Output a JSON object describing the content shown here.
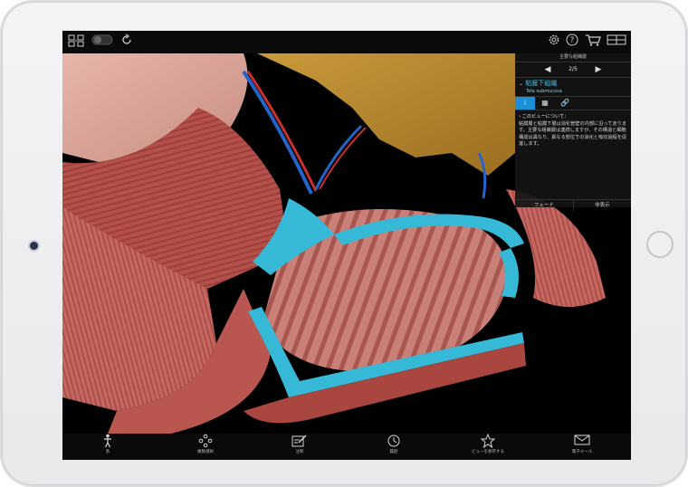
{
  "topbar": {
    "icons": [
      "layers-icon",
      "toggle-icon",
      "reset-icon",
      "settings-icon",
      "help-icon",
      "cart-icon",
      "views-icon"
    ],
    "help_glyph": "?"
  },
  "panel": {
    "header": "主要な組織層",
    "nav_page": "2/5",
    "prev_glyph": "◀",
    "next_glyph": "▶",
    "title_jp": "粘膜下組織",
    "title_latin": "Tela submucosa",
    "tabs": [
      "i",
      "▦",
      "🔗"
    ],
    "body_heading": "このビューについて：",
    "body_text": "粘膜層と粘膜下層は消化管壁の内部に沿って走ります。主要な組織層は連続しますが、その構造と細胞構成は異なり、異なる部位での消化と吸収過程を促進します。",
    "fade_button": "フェード",
    "hide_button": "非表示"
  },
  "bottombar": {
    "items": [
      {
        "label": "系",
        "icon": "anatomy-icon"
      },
      {
        "label": "複数選択",
        "icon": "multiselect-icon"
      },
      {
        "label": "注釈",
        "icon": "annotate-icon"
      },
      {
        "label": "履歴",
        "icon": "history-icon"
      },
      {
        "label": "ビューを保存する",
        "icon": "star-icon"
      },
      {
        "label": "電子メール",
        "icon": "mail-icon"
      }
    ]
  },
  "colors": {
    "submucosa": "#35b9d6",
    "muscle": "#b4504a",
    "accent": "#1c8fd6"
  }
}
